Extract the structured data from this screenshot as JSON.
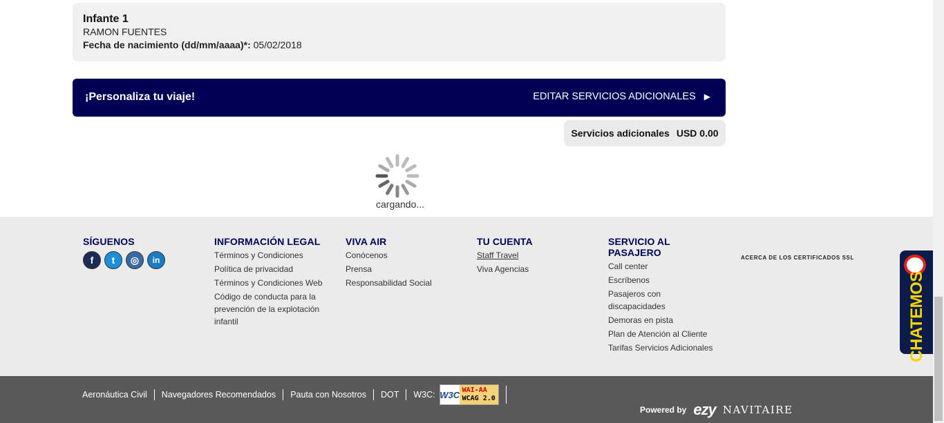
{
  "infant": {
    "title": "Infante 1",
    "name": "RAMON FUENTES",
    "dob_label": "Fecha de nacimiento (dd/mm/aaaa)*:",
    "dob_value": " 05/02/2018"
  },
  "personaliza": {
    "title": "¡Personaliza tu viaje!",
    "link": "EDITAR SERVICIOS ADICIONALES",
    "arrow": "▶"
  },
  "servicios": {
    "label": "Servicios adicionales",
    "value": "USD 0.00"
  },
  "loader": {
    "text": "cargando..."
  },
  "footer": {
    "siguenos": {
      "title": "SÍGUENOS",
      "icons": [
        "facebook-icon",
        "twitter-icon",
        "instagram-icon",
        "linkedin-icon"
      ]
    },
    "legal": {
      "title": "INFORMACIÓN LEGAL",
      "items": [
        "Términos y Condiciones",
        "Política de privacidad",
        "Términos y Condiciones Web",
        "Código de conducta para la prevención de la explotación infantil"
      ]
    },
    "vivaair": {
      "title": "VIVA AIR",
      "items": [
        "Conócenos",
        "Prensa",
        "Responsabilidad Social"
      ]
    },
    "cuenta": {
      "title": "TU CUENTA",
      "items": [
        "Staff Travel",
        "Viva Agencias"
      ]
    },
    "pasajero": {
      "title": "SERVICIO AL PASAJERO",
      "items": [
        "Call center",
        "Escríbenos",
        "Pasajeros con discapacidades",
        "Demoras en pista",
        "Plan de Atención al Cliente",
        "Tarifas Servicios Adicionales"
      ]
    },
    "ssl": "ACERCA DE LOS CERTIFICADOS SSL"
  },
  "chat": {
    "label": "CHATEMOS"
  },
  "bottom": {
    "links": [
      "Aeronáutica Civil",
      "Navegadores Recomendados",
      "Pauta con Nosotros",
      "DOT"
    ],
    "w3c_label": "W3C:",
    "badge": {
      "w3c": "W3C",
      "wai_line1": "WAI-AA",
      "wai_line2": "WCAG 2.0"
    },
    "powered_by": "Powered by",
    "brand1": "ezy",
    "brand2": "NAVITAIRE"
  },
  "colors": {
    "navy": "#000054",
    "footer_bg": "#ebebeb",
    "bottom_bg": "#595959",
    "chat_yellow": "#f5d400"
  }
}
